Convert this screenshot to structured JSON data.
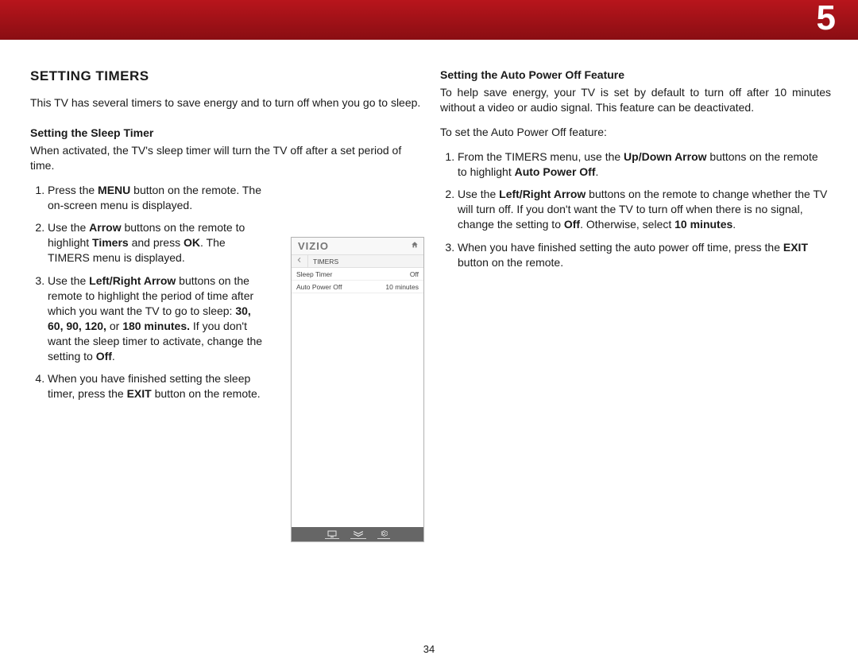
{
  "chapter": "5",
  "page_number": "34",
  "left": {
    "title": "SETTING TIMERS",
    "intro": "This TV has several timers to save energy and to turn off when you go to sleep.",
    "sub1_heading": "Setting the Sleep Timer",
    "sub1_text": "When activated, the TV's sleep timer will turn the TV off after a set period of time."
  },
  "right": {
    "sub_heading": "Setting the Auto Power Off Feature",
    "sub_text": "To help save energy, your TV is set by default to turn off after 10 minutes without a video or audio signal. This feature can be deactivated.",
    "lead": "To set the Auto Power Off feature:"
  },
  "menu": {
    "logo": "VIZIO",
    "breadcrumb": "TIMERS",
    "rows": [
      {
        "label": "Sleep Timer",
        "value": "Off"
      },
      {
        "label": "Auto Power Off",
        "value": "10 minutes"
      }
    ]
  }
}
